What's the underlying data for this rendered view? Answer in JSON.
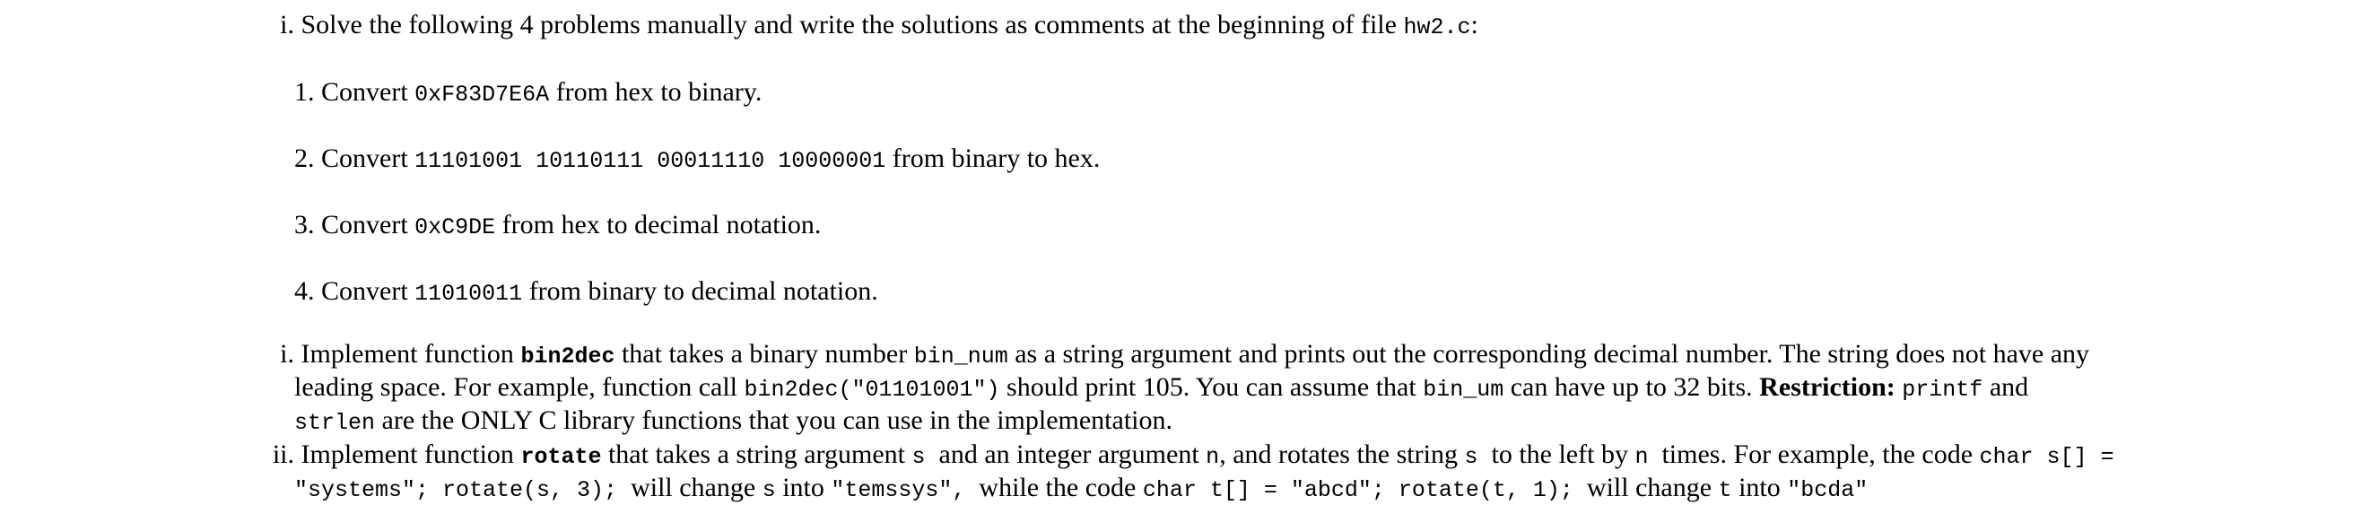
{
  "intro": {
    "marker": "i.",
    "text": "Solve the following 4 problems manually and write the solutions as comments at the beginning of file ",
    "file": "hw2.c",
    "suffix": ":"
  },
  "problems": [
    {
      "marker": "1.",
      "pre": "Convert ",
      "code": "0xF83D7E6A",
      "post": " from hex to binary."
    },
    {
      "marker": "2.",
      "pre": "Convert ",
      "code": "11101001 10110111 00011110 10000001",
      "post": " from binary to hex."
    },
    {
      "marker": "3.",
      "pre": "Convert ",
      "code": "0xC9DE",
      "post": " from hex to decimal notation."
    },
    {
      "marker": "4.",
      "pre": "Convert ",
      "code": "11010011",
      "post": " from binary to decimal notation."
    }
  ],
  "task_bin2dec": {
    "marker": "i.",
    "l1_a": "Implement function ",
    "l1_func": "bin2dec",
    "l1_b": " that takes a binary number ",
    "l1_arg": "bin_num",
    "l1_c": " as a string argument and prints out the corresponding decimal number. The string does not have any",
    "l2_a": "leading space. For example, function call ",
    "l2_call": "bin2dec(\"01101001\")",
    "l2_b": " should print 105. You can assume that ",
    "l2_arg": "bin_um",
    "l2_c": " can have up to 32 bits. ",
    "l2_bold": "Restriction:",
    "l2_d": " ",
    "l2_printf": "printf",
    "l2_e": " and",
    "l3_strlen": "strlen",
    "l3_a": " are the ONLY C library functions that you can use in the implementation."
  },
  "task_rotate": {
    "marker": "ii.",
    "l1_a": "Implement function ",
    "l1_func": "rotate",
    "l1_b": " that takes a string argument ",
    "l1_s": "s",
    "l1_c": "  and an integer argument ",
    "l1_n": "n",
    "l1_d": ", and rotates the string ",
    "l1_s2": "s",
    "l1_e": "  to the left by ",
    "l1_n2": "n",
    "l1_f": "  times. For example, the code ",
    "l1_code": "char s[] =",
    "l2_code1": "\"systems\"; rotate(s, 3);",
    "l2_a": "  will change ",
    "l2_s": "s",
    "l2_b": " into ",
    "l2_res1": "\"temssys\",",
    "l2_c": "  while the code ",
    "l2_code2": "char t[] = \"abcd\"; rotate(t, 1);",
    "l2_d": "  will change ",
    "l2_t": "t",
    "l2_e": " into ",
    "l2_res2": "\"bcda\""
  }
}
